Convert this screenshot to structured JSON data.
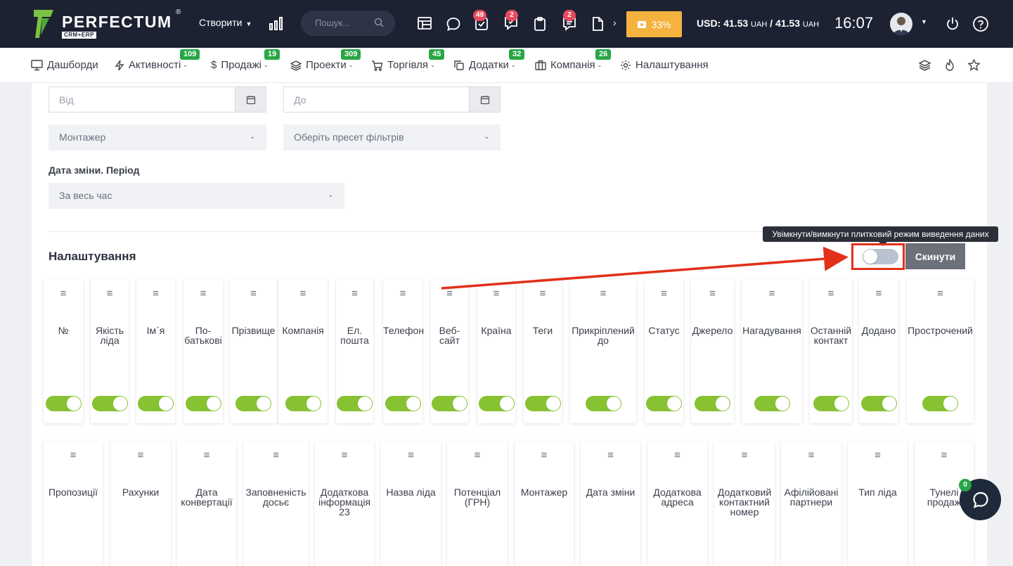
{
  "app": {
    "brand": "PERFECTUM",
    "brand_sub": "CRM+ERP",
    "brand_reg": "®"
  },
  "topbar": {
    "create_label": "Створити",
    "search_placeholder": "Пошук...",
    "badges": {
      "tasks": "49",
      "chat_tasks": "2",
      "messages": "2"
    },
    "progress_label": "33%",
    "progress_value": 33,
    "currency": "USD: 41.53",
    "currency_unit": "UAH",
    "currency_sep": " / 41.53",
    "currency_unit2": "UAH",
    "clock": "16:07"
  },
  "nav": {
    "items": [
      {
        "label": "Дашборди",
        "badge": ""
      },
      {
        "label": "Активності",
        "badge": "109"
      },
      {
        "label": "Продажі",
        "badge": "19"
      },
      {
        "label": "Проекти",
        "badge": "309"
      },
      {
        "label": "Торгівля",
        "badge": "45"
      },
      {
        "label": "Додатки",
        "badge": "32"
      },
      {
        "label": "Компанія",
        "badge": "26"
      },
      {
        "label": "Налаштування",
        "badge": ""
      }
    ]
  },
  "filters": {
    "from_placeholder": "Від",
    "to_placeholder": "До",
    "installer_select": "Монтажер",
    "preset_select": "Оберіть пресет фільтрів",
    "change_date_label": "Дата зміни. Період",
    "change_date_select": "За весь час"
  },
  "settings": {
    "title": "Налаштування",
    "tooltip": "Увімкнути/вимкнути плитковий режим виведення даних",
    "tile_mode_enabled": false,
    "reset_label": "Скинути",
    "row1": [
      {
        "name": "№",
        "on": true
      },
      {
        "name": "Якість ліда",
        "on": true
      },
      {
        "name": "Ім᾽я",
        "on": true
      },
      {
        "name": "По-батькові",
        "on": true
      },
      {
        "name": "Прізвище",
        "on": true
      },
      {
        "name": "Компанія",
        "on": true
      },
      {
        "name": "Ел. пошта",
        "on": true
      },
      {
        "name": "Телефон",
        "on": true
      },
      {
        "name": "Веб-сайт",
        "on": true
      },
      {
        "name": "Країна",
        "on": true
      },
      {
        "name": "Теги",
        "on": true
      },
      {
        "name": "Прикріплений до",
        "on": true
      },
      {
        "name": "Статус",
        "on": true
      },
      {
        "name": "Джерело",
        "on": true
      },
      {
        "name": "Нагадування",
        "on": true
      },
      {
        "name": "Останній контакт",
        "on": true
      },
      {
        "name": "Додано",
        "on": true
      },
      {
        "name": "Прострочений",
        "on": true
      }
    ],
    "row2": [
      {
        "name": "Пропозиції"
      },
      {
        "name": "Рахунки"
      },
      {
        "name": "Дата конвертації"
      },
      {
        "name": "Заповненість досьє"
      },
      {
        "name": "Додаткова інформація 23"
      },
      {
        "name": "Назва ліда"
      },
      {
        "name": "Потенціал (ГРН)"
      },
      {
        "name": "Монтажер"
      },
      {
        "name": "Дата зміни"
      },
      {
        "name": "Додаткова адреса"
      },
      {
        "name": "Додатковий контактний номер"
      },
      {
        "name": "Афілійовані партнери"
      },
      {
        "name": "Тип ліда"
      },
      {
        "name": "Тунелі продаж"
      }
    ]
  },
  "chat": {
    "badge": "0"
  }
}
